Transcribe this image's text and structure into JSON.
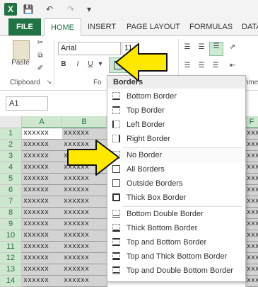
{
  "quick_access": {
    "logo": "X",
    "save_icon": "save-icon",
    "undo_icon": "undo-icon",
    "redo_icon": "redo-icon",
    "customize_icon": "customize-icon"
  },
  "tabs": [
    {
      "label": "FILE"
    },
    {
      "label": "HOME"
    },
    {
      "label": "INSERT"
    },
    {
      "label": "PAGE LAYOUT"
    },
    {
      "label": "FORMULAS"
    },
    {
      "label": "DATA"
    }
  ],
  "ribbon": {
    "clipboard": {
      "paste_label": "Paste",
      "group_label": "Clipboard"
    },
    "font": {
      "name": "Arial",
      "size": "11",
      "bold": "B",
      "italic": "I",
      "underline": "U",
      "group_label": "Fo"
    },
    "alignment_label": "ignme"
  },
  "name_box": "A1",
  "columns": [
    {
      "label": "A",
      "selected": true
    },
    {
      "label": "B",
      "selected": true
    },
    {
      "label": "F",
      "selected": true
    }
  ],
  "rows": [
    "1",
    "2",
    "3",
    "4",
    "5",
    "6",
    "7",
    "8",
    "9",
    "10",
    "11",
    "12",
    "13",
    "14"
  ],
  "cell_text": "xxxxxx",
  "menu": {
    "title": "Borders",
    "items": [
      {
        "label": "Bottom Border"
      },
      {
        "label": "Top Border"
      },
      {
        "label": "Left Border"
      },
      {
        "label": "Right Border"
      },
      {
        "label": "No Border"
      },
      {
        "label": "All Borders"
      },
      {
        "label": "Outside Borders"
      },
      {
        "label": "Thick Box Border"
      },
      {
        "label": "Bottom Double Border"
      },
      {
        "label": "Thick Bottom Border"
      },
      {
        "label": "Top and Bottom Border"
      },
      {
        "label": "Top and Thick Bottom Border"
      },
      {
        "label": "Top and Double Bottom Border"
      }
    ]
  },
  "colors": {
    "accent": "#217346",
    "arrow": "#ffe800",
    "selection": "#d3d3d3"
  }
}
